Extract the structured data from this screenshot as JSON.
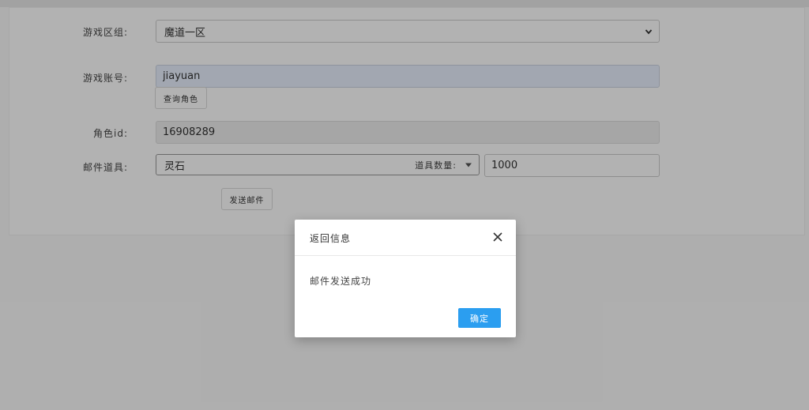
{
  "form": {
    "zone": {
      "label": "游戏区组:",
      "selected": "魔道一区"
    },
    "account": {
      "label": "游戏账号:",
      "value": "jiayuan",
      "query_button": "查询角色"
    },
    "role_id": {
      "label": "角色id:",
      "value": "16908289"
    },
    "mail_item": {
      "label": "邮件道具:",
      "item_name": "灵石",
      "qty_label": "道具数量:",
      "qty_value": "1000"
    },
    "send_button": "发送邮件"
  },
  "dialog": {
    "title": "返回信息",
    "message": "邮件发送成功",
    "confirm_label": "确定"
  },
  "colors": {
    "primary_button": "#2b9ef0",
    "autofill_bg": "#e8f0fe"
  }
}
